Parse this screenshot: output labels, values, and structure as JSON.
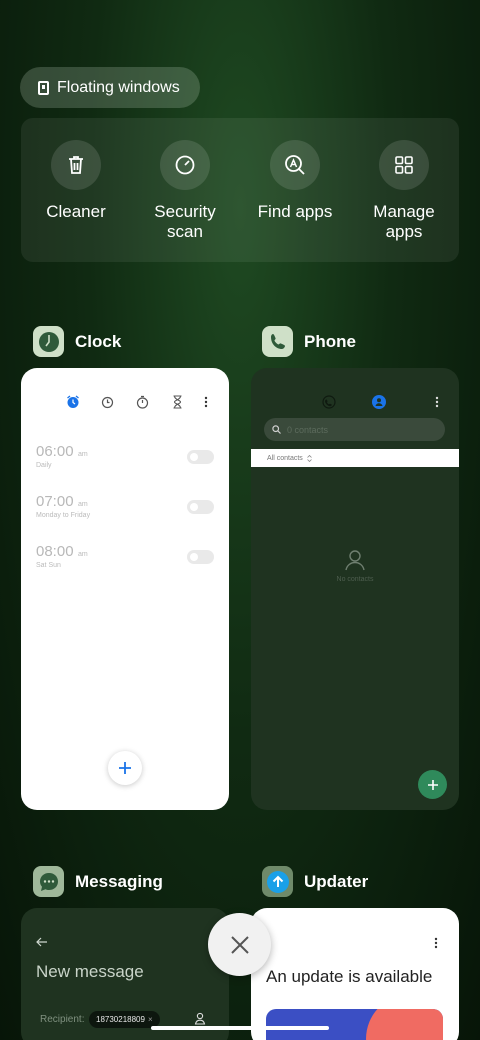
{
  "floating": {
    "label": "Floating windows"
  },
  "tools": [
    {
      "label": "Cleaner",
      "icon": "trash-icon"
    },
    {
      "label": "Security\nscan",
      "icon": "security-scan-icon"
    },
    {
      "label": "Find apps",
      "icon": "find-apps-icon"
    },
    {
      "label": "Manage\napps",
      "icon": "grid-icon"
    }
  ],
  "apps": {
    "clock": {
      "name": "Clock",
      "alarms": [
        {
          "time": "06:00",
          "ampm": "am",
          "repeat": "Daily"
        },
        {
          "time": "07:00",
          "ampm": "am",
          "repeat": "Monday to Friday"
        },
        {
          "time": "08:00",
          "ampm": "am",
          "repeat": "Sat Sun"
        }
      ]
    },
    "phone": {
      "name": "Phone",
      "search_placeholder": "0 contacts",
      "filter": "All contacts",
      "empty_text": "No contacts"
    },
    "messaging": {
      "name": "Messaging",
      "title": "New message",
      "recipient_label": "Recipient:",
      "recipient_chip": "18730218809"
    },
    "updater": {
      "name": "Updater",
      "title": "An update is available"
    }
  },
  "colors": {
    "accent_blue": "#1a73e8",
    "phone_fab": "#2f8a5b"
  }
}
